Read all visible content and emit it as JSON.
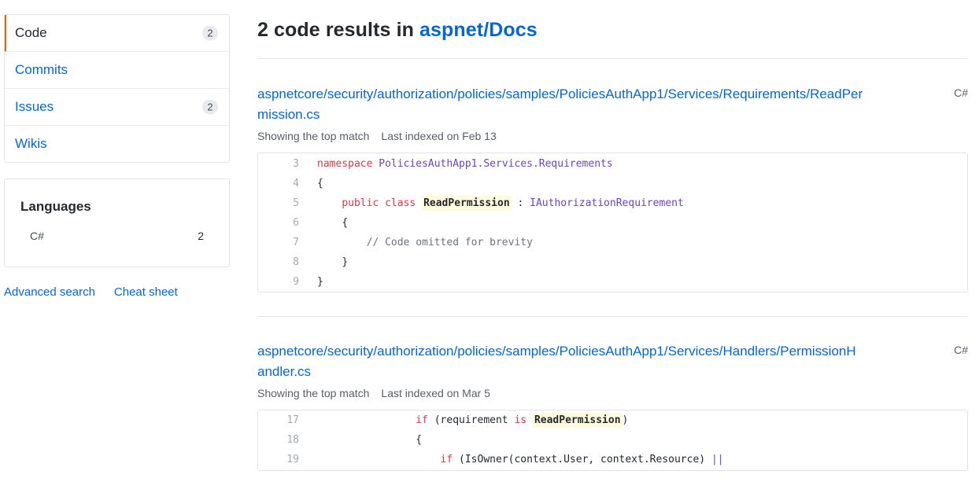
{
  "sidebar": {
    "items": [
      {
        "label": "Code",
        "count": "2"
      },
      {
        "label": "Commits",
        "count": ""
      },
      {
        "label": "Issues",
        "count": "2"
      },
      {
        "label": "Wikis",
        "count": ""
      }
    ],
    "languages": {
      "title": "Languages",
      "entries": [
        {
          "name": "C#",
          "count": "2"
        }
      ]
    },
    "links": {
      "advanced_search": "Advanced search",
      "cheat_sheet": "Cheat sheet"
    }
  },
  "header": {
    "count_text": "2 code results in",
    "repo": "aspnet/Docs"
  },
  "results": [
    {
      "path": "aspnetcore/security/authorization/policies/samples/PoliciesAuthApp1/Services/Requirements/ReadPermission.cs",
      "language": "C#",
      "match_text": "Showing the top match",
      "indexed_text": "Last indexed on Feb 13",
      "lines": [
        {
          "num": "3",
          "indent": "",
          "segments": [
            {
              "t": "namespace",
              "c": "kw"
            },
            {
              "t": " "
            },
            {
              "t": "PoliciesAuthApp1.Services.Requirements",
              "c": "ty"
            }
          ]
        },
        {
          "num": "4",
          "indent": "",
          "segments": [
            {
              "t": "{"
            }
          ]
        },
        {
          "num": "5",
          "indent": "    ",
          "segments": [
            {
              "t": "public",
              "c": "kw"
            },
            {
              "t": " "
            },
            {
              "t": "class",
              "c": "kw"
            },
            {
              "t": " "
            },
            {
              "t": "ReadPermission",
              "c": "hl"
            },
            {
              "t": " : "
            },
            {
              "t": "IAuthorizationRequirement",
              "c": "ty"
            }
          ]
        },
        {
          "num": "6",
          "indent": "    ",
          "segments": [
            {
              "t": "{"
            }
          ]
        },
        {
          "num": "7",
          "indent": "        ",
          "segments": [
            {
              "t": "// Code omitted for brevity",
              "c": "cm"
            }
          ]
        },
        {
          "num": "8",
          "indent": "    ",
          "segments": [
            {
              "t": "}"
            }
          ]
        },
        {
          "num": "9",
          "indent": "",
          "segments": [
            {
              "t": "}"
            }
          ]
        }
      ]
    },
    {
      "path": "aspnetcore/security/authorization/policies/samples/PoliciesAuthApp1/Services/Handlers/PermissionHandler.cs",
      "language": "C#",
      "match_text": "Showing the top match",
      "indexed_text": "Last indexed on Mar 5",
      "lines": [
        {
          "num": "17",
          "indent": "                ",
          "segments": [
            {
              "t": "if",
              "c": "kw"
            },
            {
              "t": " (requirement "
            },
            {
              "t": "is",
              "c": "kw"
            },
            {
              "t": " "
            },
            {
              "t": "ReadPermission",
              "c": "hl"
            },
            {
              "t": ")"
            }
          ]
        },
        {
          "num": "18",
          "indent": "                ",
          "segments": [
            {
              "t": "{"
            }
          ]
        },
        {
          "num": "19",
          "indent": "                    ",
          "segments": [
            {
              "t": "if",
              "c": "kw"
            },
            {
              "t": " (IsOwner(context.User, context.Resource) "
            },
            {
              "t": "||",
              "c": "ty"
            }
          ]
        }
      ]
    }
  ]
}
